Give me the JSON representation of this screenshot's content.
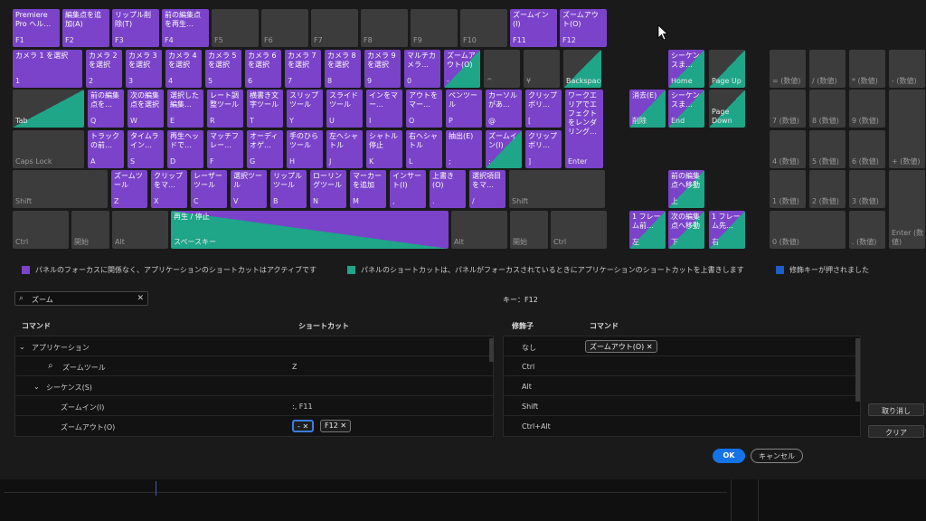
{
  "keyboard": {
    "row0": [
      {
        "label": "Premiere Pro ヘル…",
        "sub": "F1",
        "type": "app"
      },
      {
        "label": "編集点を追加(A)",
        "sub": "F2",
        "type": "app"
      },
      {
        "label": "リップル削除(T)",
        "sub": "F3",
        "type": "app"
      },
      {
        "label": "前の編集点を再生…",
        "sub": "F4",
        "type": "app"
      },
      {
        "label": "",
        "sub": "F5",
        "type": "empty"
      },
      {
        "label": "",
        "sub": "F6",
        "type": "empty"
      },
      {
        "label": "",
        "sub": "F7",
        "type": "empty"
      },
      {
        "label": "",
        "sub": "F8",
        "type": "empty"
      },
      {
        "label": "",
        "sub": "F9",
        "type": "empty"
      },
      {
        "label": "",
        "sub": "F10",
        "type": "empty"
      },
      {
        "label": "ズームイン(I)",
        "sub": "F11",
        "type": "app"
      },
      {
        "label": "ズームアウト(O)",
        "sub": "F12",
        "type": "app"
      }
    ],
    "row1": [
      {
        "label": "カメラ 1 を選択",
        "sub": "1",
        "type": "app"
      },
      {
        "label": "カメラ 2 を選択",
        "sub": "2",
        "type": "app"
      },
      {
        "label": "カメラ 3 を選択",
        "sub": "3",
        "type": "app"
      },
      {
        "label": "カメラ 4 を選択",
        "sub": "4",
        "type": "app"
      },
      {
        "label": "カメラ 5 を選択",
        "sub": "5",
        "type": "app"
      },
      {
        "label": "カメラ 6 を選択",
        "sub": "6",
        "type": "app"
      },
      {
        "label": "カメラ 7 を選択",
        "sub": "7",
        "type": "app"
      },
      {
        "label": "カメラ 8 を選択",
        "sub": "8",
        "type": "app"
      },
      {
        "label": "カメラ 9 を選択",
        "sub": "9",
        "type": "app"
      },
      {
        "label": "マルチカメラ…",
        "sub": "0",
        "type": "app"
      },
      {
        "label": "ズームアウト(O)",
        "sub": "-",
        "type": "both"
      },
      {
        "label": "",
        "sub": "^",
        "type": "empty"
      },
      {
        "label": "",
        "sub": "¥",
        "type": "empty"
      },
      {
        "label": "",
        "sub": "Backspace",
        "type": "pb"
      }
    ],
    "row2": [
      {
        "label": "",
        "sub": "Tab",
        "type": "pb"
      },
      {
        "label": "前の編集点を…",
        "sub": "Q",
        "type": "app"
      },
      {
        "label": "次の編集点を選択",
        "sub": "W",
        "type": "app"
      },
      {
        "label": "選択した編集…",
        "sub": "E",
        "type": "app"
      },
      {
        "label": "レート調整ツール",
        "sub": "R",
        "type": "app"
      },
      {
        "label": "横書き文字ツール",
        "sub": "T",
        "type": "app"
      },
      {
        "label": "スリップツール",
        "sub": "Y",
        "type": "app"
      },
      {
        "label": "スライドツール",
        "sub": "U",
        "type": "app"
      },
      {
        "label": "インをマー…",
        "sub": "I",
        "type": "app"
      },
      {
        "label": "アウトをマー…",
        "sub": "O",
        "type": "app"
      },
      {
        "label": "ペンツール",
        "sub": "P",
        "type": "app"
      },
      {
        "label": "カーソルがあ…",
        "sub": "@",
        "type": "app"
      },
      {
        "label": "クリップボリ…",
        "sub": "[",
        "type": "app"
      },
      {
        "label": "ワークエリアでエフェクトをレンダリング…",
        "sub": "Enter",
        "type": "app"
      }
    ],
    "row3": [
      {
        "label": "",
        "sub": "Caps Lock",
        "type": "empty"
      },
      {
        "label": "トラックの前…",
        "sub": "A",
        "type": "app"
      },
      {
        "label": "タイムライン…",
        "sub": "S",
        "type": "app"
      },
      {
        "label": "再生ヘッドで…",
        "sub": "D",
        "type": "app"
      },
      {
        "label": "マッチフレー…",
        "sub": "F",
        "type": "app"
      },
      {
        "label": "オーディオゲ…",
        "sub": "G",
        "type": "app"
      },
      {
        "label": "手のひらツール",
        "sub": "H",
        "type": "app"
      },
      {
        "label": "左へシャトル",
        "sub": "J",
        "type": "app"
      },
      {
        "label": "シャトル停止",
        "sub": "K",
        "type": "app"
      },
      {
        "label": "右へシャトル",
        "sub": "L",
        "type": "app"
      },
      {
        "label": "抽出(E)",
        "sub": ";",
        "type": "app"
      },
      {
        "label": "ズームイン(I)",
        "sub": ":",
        "type": "both"
      },
      {
        "label": "クリップボリ…",
        "sub": "]",
        "type": "app"
      }
    ],
    "row4": [
      {
        "label": "",
        "sub": "Shift",
        "type": "empty"
      },
      {
        "label": "ズームツール",
        "sub": "Z",
        "type": "app"
      },
      {
        "label": "クリップをマ…",
        "sub": "X",
        "type": "app"
      },
      {
        "label": "レーザーツール",
        "sub": "C",
        "type": "app"
      },
      {
        "label": "選択ツール",
        "sub": "V",
        "type": "app"
      },
      {
        "label": "リップルツール",
        "sub": "B",
        "type": "app"
      },
      {
        "label": "ローリングツール",
        "sub": "N",
        "type": "app"
      },
      {
        "label": "マーカーを追加",
        "sub": "M",
        "type": "app"
      },
      {
        "label": "インサート(I)",
        "sub": ",",
        "type": "app"
      },
      {
        "label": "上書き(O)",
        "sub": ".",
        "type": "app"
      },
      {
        "label": "選択項目をマ…",
        "sub": "/",
        "type": "app"
      },
      {
        "label": "",
        "sub": "Shift",
        "type": "empty"
      }
    ],
    "row5": [
      {
        "label": "",
        "sub": "Ctrl",
        "type": "empty"
      },
      {
        "label": "",
        "sub": "開始",
        "type": "empty"
      },
      {
        "label": "",
        "sub": "Alt",
        "type": "empty"
      },
      {
        "label": "再生 / 停止",
        "sub": "スペースキー",
        "type": "space"
      },
      {
        "label": "",
        "sub": "Alt",
        "type": "empty"
      },
      {
        "label": "",
        "sub": "開始",
        "type": "empty"
      },
      {
        "label": "",
        "sub": "Ctrl",
        "type": "empty"
      }
    ],
    "nav": [
      {
        "label": "シーケンスま…",
        "sub": "Home",
        "type": "both"
      },
      {
        "label": "",
        "sub": "Page Up",
        "type": "pb"
      },
      {
        "label": "消去(E)",
        "sub": "削除",
        "type": "both"
      },
      {
        "label": "シーケンスま…",
        "sub": "End",
        "type": "both"
      },
      {
        "label": "",
        "sub": "Page Down",
        "type": "pb"
      }
    ],
    "arrows": [
      {
        "label": "前の編集点へ移動",
        "sub": "上",
        "type": "both"
      },
      {
        "label": "1 フレーム前…",
        "sub": "左",
        "type": "both"
      },
      {
        "label": "次の編集点へ移動",
        "sub": "下",
        "type": "both"
      },
      {
        "label": "1 フレーム先…",
        "sub": "右",
        "type": "both"
      }
    ],
    "numpad": [
      {
        "sub": "= (数値)"
      },
      {
        "sub": "/ (数値)"
      },
      {
        "sub": "* (数値)"
      },
      {
        "sub": "- (数値)"
      },
      {
        "sub": "7 (数値)"
      },
      {
        "sub": "8 (数値)"
      },
      {
        "sub": "9 (数値)"
      },
      {
        "sub": "4 (数値)"
      },
      {
        "sub": "5 (数値)"
      },
      {
        "sub": "6 (数値)"
      },
      {
        "sub": "+ (数値)"
      },
      {
        "sub": "1 (数値)"
      },
      {
        "sub": "2 (数値)"
      },
      {
        "sub": "3 (数値)"
      },
      {
        "sub": "0 (数値)"
      },
      {
        "sub": ". (数値)"
      },
      {
        "sub": "Enter (数値)"
      }
    ]
  },
  "legend": {
    "app": "パネルのフォーカスに関係なく、アプリケーションのショートカットはアクティブです",
    "panel": "パネルのショートカットは、パネルがフォーカスされているときにアプリケーションのショートカットを上書きします",
    "modifier": "修飾キーが押されました"
  },
  "colors": {
    "app": "#7a43c9",
    "panel": "#1fa588",
    "modifier": "#1e5fc9",
    "accent": "#1473e6"
  },
  "search": {
    "value": "ズーム"
  },
  "key_info": "キー：F12",
  "table": {
    "col_command": "コマンド",
    "col_shortcut": "ショートカット",
    "rows": [
      {
        "name": "アプリケーション",
        "shortcut": ""
      },
      {
        "name": "ズームツール",
        "shortcut": "Z"
      },
      {
        "name": "シーケンス(S)",
        "shortcut": ""
      },
      {
        "name": "ズームイン(I)",
        "shortcut": ":, F11"
      },
      {
        "name": "ズームアウト(O)",
        "chips": [
          "-",
          "F12"
        ]
      }
    ]
  },
  "modifiers": {
    "col_modifier": "修飾子",
    "col_command": "コマンド",
    "rows": [
      {
        "mod": "なし",
        "command": "ズームアウト(O)"
      },
      {
        "mod": "Ctrl",
        "command": ""
      },
      {
        "mod": "Alt",
        "command": ""
      },
      {
        "mod": "Shift",
        "command": ""
      },
      {
        "mod": "Ctrl+Alt",
        "command": ""
      }
    ]
  },
  "buttons": {
    "undo": "取り消し",
    "clear": "クリア",
    "ok": "OK",
    "cancel": "キャンセル"
  }
}
